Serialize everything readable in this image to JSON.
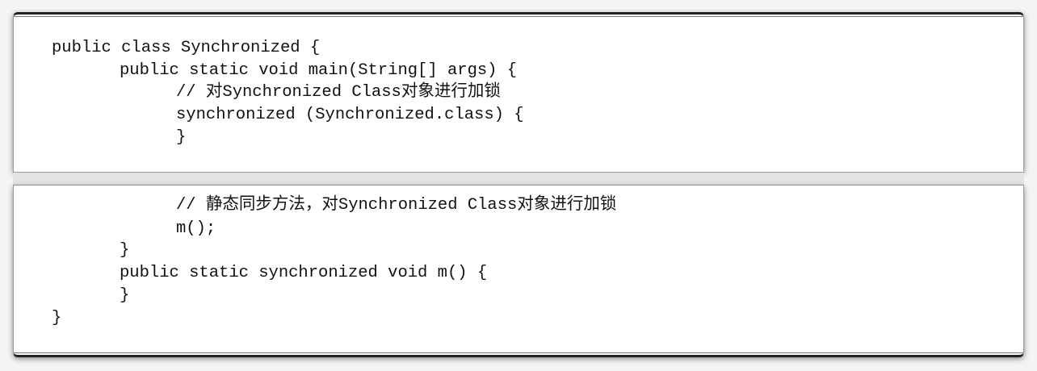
{
  "top_snippet": {
    "lines": [
      "public class Synchronized {",
      "public static void main(String[] args) {",
      "// 对Synchronized Class对象进行加锁",
      "synchronized (Synchronized.class) {",
      "}"
    ]
  },
  "bottom_snippet": {
    "lines": [
      "// 静态同步方法，对Synchronized Class对象进行加锁",
      "m();",
      "}",
      "public static synchronized void m() {",
      "}",
      "}"
    ]
  }
}
